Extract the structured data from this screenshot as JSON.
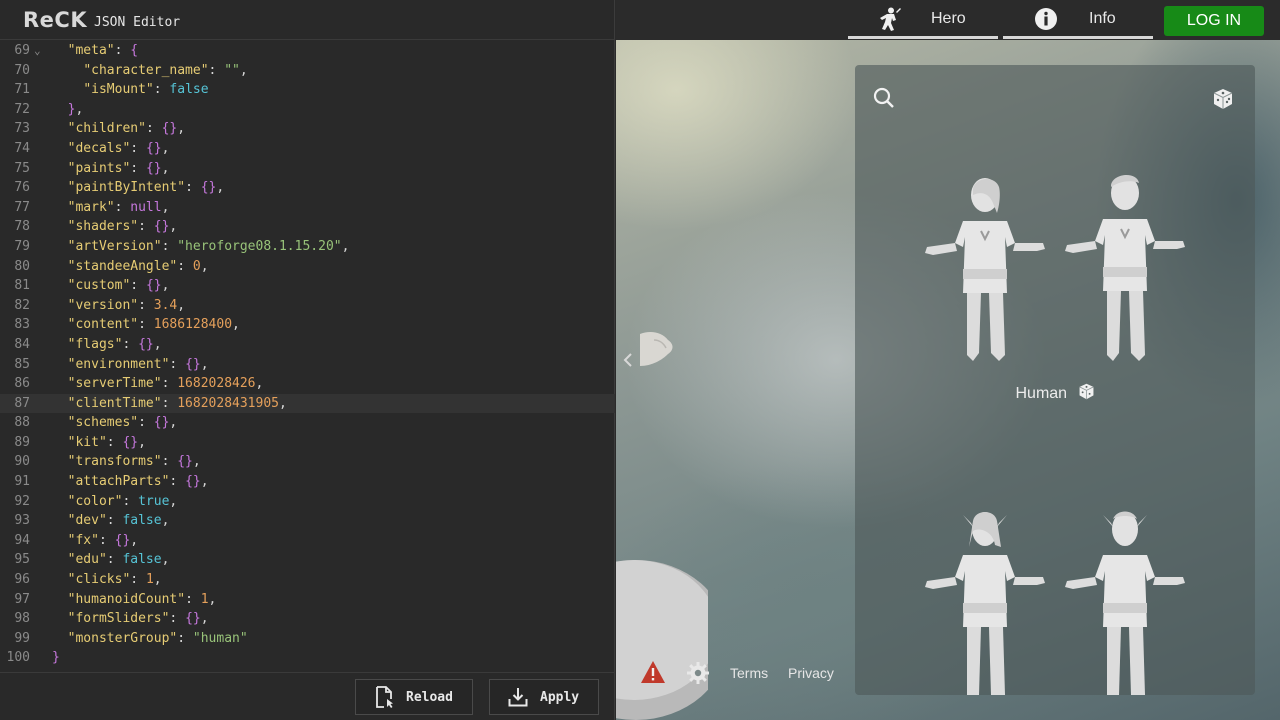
{
  "editor": {
    "logo": "ReCK",
    "title": "JSON Editor",
    "lines": [
      {
        "num": "69",
        "fold": "⌄",
        "tokens": [
          {
            "t": "  "
          },
          {
            "t": "\"meta\"",
            "c": "k"
          },
          {
            "t": ": ",
            "c": "p"
          },
          {
            "t": "{",
            "c": "br"
          }
        ]
      },
      {
        "num": "70",
        "tokens": [
          {
            "t": "    "
          },
          {
            "t": "\"character_name\"",
            "c": "k"
          },
          {
            "t": ": ",
            "c": "p"
          },
          {
            "t": "\"\"",
            "c": "s"
          },
          {
            "t": ",",
            "c": "p"
          }
        ]
      },
      {
        "num": "71",
        "tokens": [
          {
            "t": "    "
          },
          {
            "t": "\"isMount\"",
            "c": "k"
          },
          {
            "t": ": ",
            "c": "p"
          },
          {
            "t": "false",
            "c": "b"
          }
        ]
      },
      {
        "num": "72",
        "tokens": [
          {
            "t": "  "
          },
          {
            "t": "}",
            "c": "br"
          },
          {
            "t": ",",
            "c": "p"
          }
        ]
      },
      {
        "num": "73",
        "tokens": [
          {
            "t": "  "
          },
          {
            "t": "\"children\"",
            "c": "k"
          },
          {
            "t": ": ",
            "c": "p"
          },
          {
            "t": "{}",
            "c": "br"
          },
          {
            "t": ",",
            "c": "p"
          }
        ]
      },
      {
        "num": "74",
        "tokens": [
          {
            "t": "  "
          },
          {
            "t": "\"decals\"",
            "c": "k"
          },
          {
            "t": ": ",
            "c": "p"
          },
          {
            "t": "{}",
            "c": "br"
          },
          {
            "t": ",",
            "c": "p"
          }
        ]
      },
      {
        "num": "75",
        "tokens": [
          {
            "t": "  "
          },
          {
            "t": "\"paints\"",
            "c": "k"
          },
          {
            "t": ": ",
            "c": "p"
          },
          {
            "t": "{}",
            "c": "br"
          },
          {
            "t": ",",
            "c": "p"
          }
        ]
      },
      {
        "num": "76",
        "tokens": [
          {
            "t": "  "
          },
          {
            "t": "\"paintByIntent\"",
            "c": "k"
          },
          {
            "t": ": ",
            "c": "p"
          },
          {
            "t": "{}",
            "c": "br"
          },
          {
            "t": ",",
            "c": "p"
          }
        ]
      },
      {
        "num": "77",
        "tokens": [
          {
            "t": "  "
          },
          {
            "t": "\"mark\"",
            "c": "k"
          },
          {
            "t": ": ",
            "c": "p"
          },
          {
            "t": "null",
            "c": "nl"
          },
          {
            "t": ",",
            "c": "p"
          }
        ]
      },
      {
        "num": "78",
        "tokens": [
          {
            "t": "  "
          },
          {
            "t": "\"shaders\"",
            "c": "k"
          },
          {
            "t": ": ",
            "c": "p"
          },
          {
            "t": "{}",
            "c": "br"
          },
          {
            "t": ",",
            "c": "p"
          }
        ]
      },
      {
        "num": "79",
        "tokens": [
          {
            "t": "  "
          },
          {
            "t": "\"artVersion\"",
            "c": "k"
          },
          {
            "t": ": ",
            "c": "p"
          },
          {
            "t": "\"heroforge08.1.15.20\"",
            "c": "s"
          },
          {
            "t": ",",
            "c": "p"
          }
        ]
      },
      {
        "num": "80",
        "tokens": [
          {
            "t": "  "
          },
          {
            "t": "\"standeeAngle\"",
            "c": "k"
          },
          {
            "t": ": ",
            "c": "p"
          },
          {
            "t": "0",
            "c": "n"
          },
          {
            "t": ",",
            "c": "p"
          }
        ]
      },
      {
        "num": "81",
        "tokens": [
          {
            "t": "  "
          },
          {
            "t": "\"custom\"",
            "c": "k"
          },
          {
            "t": ": ",
            "c": "p"
          },
          {
            "t": "{}",
            "c": "br"
          },
          {
            "t": ",",
            "c": "p"
          }
        ]
      },
      {
        "num": "82",
        "tokens": [
          {
            "t": "  "
          },
          {
            "t": "\"version\"",
            "c": "k"
          },
          {
            "t": ": ",
            "c": "p"
          },
          {
            "t": "3.4",
            "c": "n"
          },
          {
            "t": ",",
            "c": "p"
          }
        ]
      },
      {
        "num": "83",
        "tokens": [
          {
            "t": "  "
          },
          {
            "t": "\"content\"",
            "c": "k"
          },
          {
            "t": ": ",
            "c": "p"
          },
          {
            "t": "1686128400",
            "c": "n"
          },
          {
            "t": ",",
            "c": "p"
          }
        ]
      },
      {
        "num": "84",
        "tokens": [
          {
            "t": "  "
          },
          {
            "t": "\"flags\"",
            "c": "k"
          },
          {
            "t": ": ",
            "c": "p"
          },
          {
            "t": "{}",
            "c": "br"
          },
          {
            "t": ",",
            "c": "p"
          }
        ]
      },
      {
        "num": "85",
        "tokens": [
          {
            "t": "  "
          },
          {
            "t": "\"environment\"",
            "c": "k"
          },
          {
            "t": ": ",
            "c": "p"
          },
          {
            "t": "{}",
            "c": "br"
          },
          {
            "t": ",",
            "c": "p"
          }
        ]
      },
      {
        "num": "86",
        "tokens": [
          {
            "t": "  "
          },
          {
            "t": "\"serverTime\"",
            "c": "k"
          },
          {
            "t": ": ",
            "c": "p"
          },
          {
            "t": "1682028426",
            "c": "n"
          },
          {
            "t": ",",
            "c": "p"
          }
        ]
      },
      {
        "num": "87",
        "active": true,
        "tokens": [
          {
            "t": "  "
          },
          {
            "t": "\"clientTime\"",
            "c": "k"
          },
          {
            "t": ": ",
            "c": "p"
          },
          {
            "t": "1682028431905",
            "c": "n"
          },
          {
            "t": ",",
            "c": "p"
          }
        ]
      },
      {
        "num": "88",
        "tokens": [
          {
            "t": "  "
          },
          {
            "t": "\"schemes\"",
            "c": "k"
          },
          {
            "t": ": ",
            "c": "p"
          },
          {
            "t": "{}",
            "c": "br"
          },
          {
            "t": ",",
            "c": "p"
          }
        ]
      },
      {
        "num": "89",
        "tokens": [
          {
            "t": "  "
          },
          {
            "t": "\"kit\"",
            "c": "k"
          },
          {
            "t": ": ",
            "c": "p"
          },
          {
            "t": "{}",
            "c": "br"
          },
          {
            "t": ",",
            "c": "p"
          }
        ]
      },
      {
        "num": "90",
        "tokens": [
          {
            "t": "  "
          },
          {
            "t": "\"transforms\"",
            "c": "k"
          },
          {
            "t": ": ",
            "c": "p"
          },
          {
            "t": "{}",
            "c": "br"
          },
          {
            "t": ",",
            "c": "p"
          }
        ]
      },
      {
        "num": "91",
        "tokens": [
          {
            "t": "  "
          },
          {
            "t": "\"attachParts\"",
            "c": "k"
          },
          {
            "t": ": ",
            "c": "p"
          },
          {
            "t": "{}",
            "c": "br"
          },
          {
            "t": ",",
            "c": "p"
          }
        ]
      },
      {
        "num": "92",
        "tokens": [
          {
            "t": "  "
          },
          {
            "t": "\"color\"",
            "c": "k"
          },
          {
            "t": ": ",
            "c": "p"
          },
          {
            "t": "true",
            "c": "b"
          },
          {
            "t": ",",
            "c": "p"
          }
        ]
      },
      {
        "num": "93",
        "tokens": [
          {
            "t": "  "
          },
          {
            "t": "\"dev\"",
            "c": "k"
          },
          {
            "t": ": ",
            "c": "p"
          },
          {
            "t": "false",
            "c": "b"
          },
          {
            "t": ",",
            "c": "p"
          }
        ]
      },
      {
        "num": "94",
        "tokens": [
          {
            "t": "  "
          },
          {
            "t": "\"fx\"",
            "c": "k"
          },
          {
            "t": ": ",
            "c": "p"
          },
          {
            "t": "{}",
            "c": "br"
          },
          {
            "t": ",",
            "c": "p"
          }
        ]
      },
      {
        "num": "95",
        "tokens": [
          {
            "t": "  "
          },
          {
            "t": "\"edu\"",
            "c": "k"
          },
          {
            "t": ": ",
            "c": "p"
          },
          {
            "t": "false",
            "c": "b"
          },
          {
            "t": ",",
            "c": "p"
          }
        ]
      },
      {
        "num": "96",
        "tokens": [
          {
            "t": "  "
          },
          {
            "t": "\"clicks\"",
            "c": "k"
          },
          {
            "t": ": ",
            "c": "p"
          },
          {
            "t": "1",
            "c": "n"
          },
          {
            "t": ",",
            "c": "p"
          }
        ]
      },
      {
        "num": "97",
        "tokens": [
          {
            "t": "  "
          },
          {
            "t": "\"humanoidCount\"",
            "c": "k"
          },
          {
            "t": ": ",
            "c": "p"
          },
          {
            "t": "1",
            "c": "n"
          },
          {
            "t": ",",
            "c": "p"
          }
        ]
      },
      {
        "num": "98",
        "tokens": [
          {
            "t": "  "
          },
          {
            "t": "\"formSliders\"",
            "c": "k"
          },
          {
            "t": ": ",
            "c": "p"
          },
          {
            "t": "{}",
            "c": "br"
          },
          {
            "t": ",",
            "c": "p"
          }
        ]
      },
      {
        "num": "99",
        "tokens": [
          {
            "t": "  "
          },
          {
            "t": "\"monsterGroup\"",
            "c": "k"
          },
          {
            "t": ": ",
            "c": "p"
          },
          {
            "t": "\"human\"",
            "c": "s"
          }
        ]
      },
      {
        "num": "100",
        "tokens": [
          {
            "t": "}",
            "c": "br"
          }
        ]
      }
    ],
    "reload_label": "Reload",
    "apply_label": "Apply"
  },
  "nav": {
    "hero_label": "Hero",
    "info_label": "Info",
    "login_label": "LOG IN",
    "login_color": "#178a17"
  },
  "picker": {
    "race_label": "Human",
    "icons": [
      "search-icon",
      "dice-icon"
    ]
  },
  "footer": {
    "terms_label": "Terms",
    "privacy_label": "Privacy",
    "icons": [
      "warning-icon",
      "gear-icon"
    ],
    "warning_color": "#c0392b"
  },
  "colors": {
    "key": "#e6cc74",
    "string": "#98c379",
    "number": "#e5a05b",
    "boolean": "#56c4d6",
    "brace": "#c678dd"
  }
}
